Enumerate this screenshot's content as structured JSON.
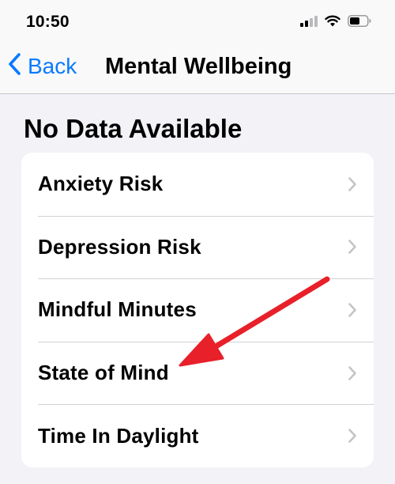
{
  "status_bar": {
    "time": "10:50",
    "icons": [
      "cellular-signal-icon",
      "wifi-icon",
      "battery-icon"
    ]
  },
  "nav": {
    "back_label": "Back",
    "title": "Mental Wellbeing"
  },
  "section": {
    "header": "No Data Available"
  },
  "list": {
    "items": [
      {
        "label": "Anxiety Risk"
      },
      {
        "label": "Depression Risk"
      },
      {
        "label": "Mindful Minutes"
      },
      {
        "label": "State of Mind"
      },
      {
        "label": "Time In Daylight"
      }
    ]
  },
  "colors": {
    "accent": "#0a7aff",
    "annotation_arrow": "#e8202a",
    "background": "#f2f2f7",
    "chevron": "#c4c4c7"
  },
  "annotation": {
    "type": "arrow",
    "points_to": "State of Mind"
  }
}
